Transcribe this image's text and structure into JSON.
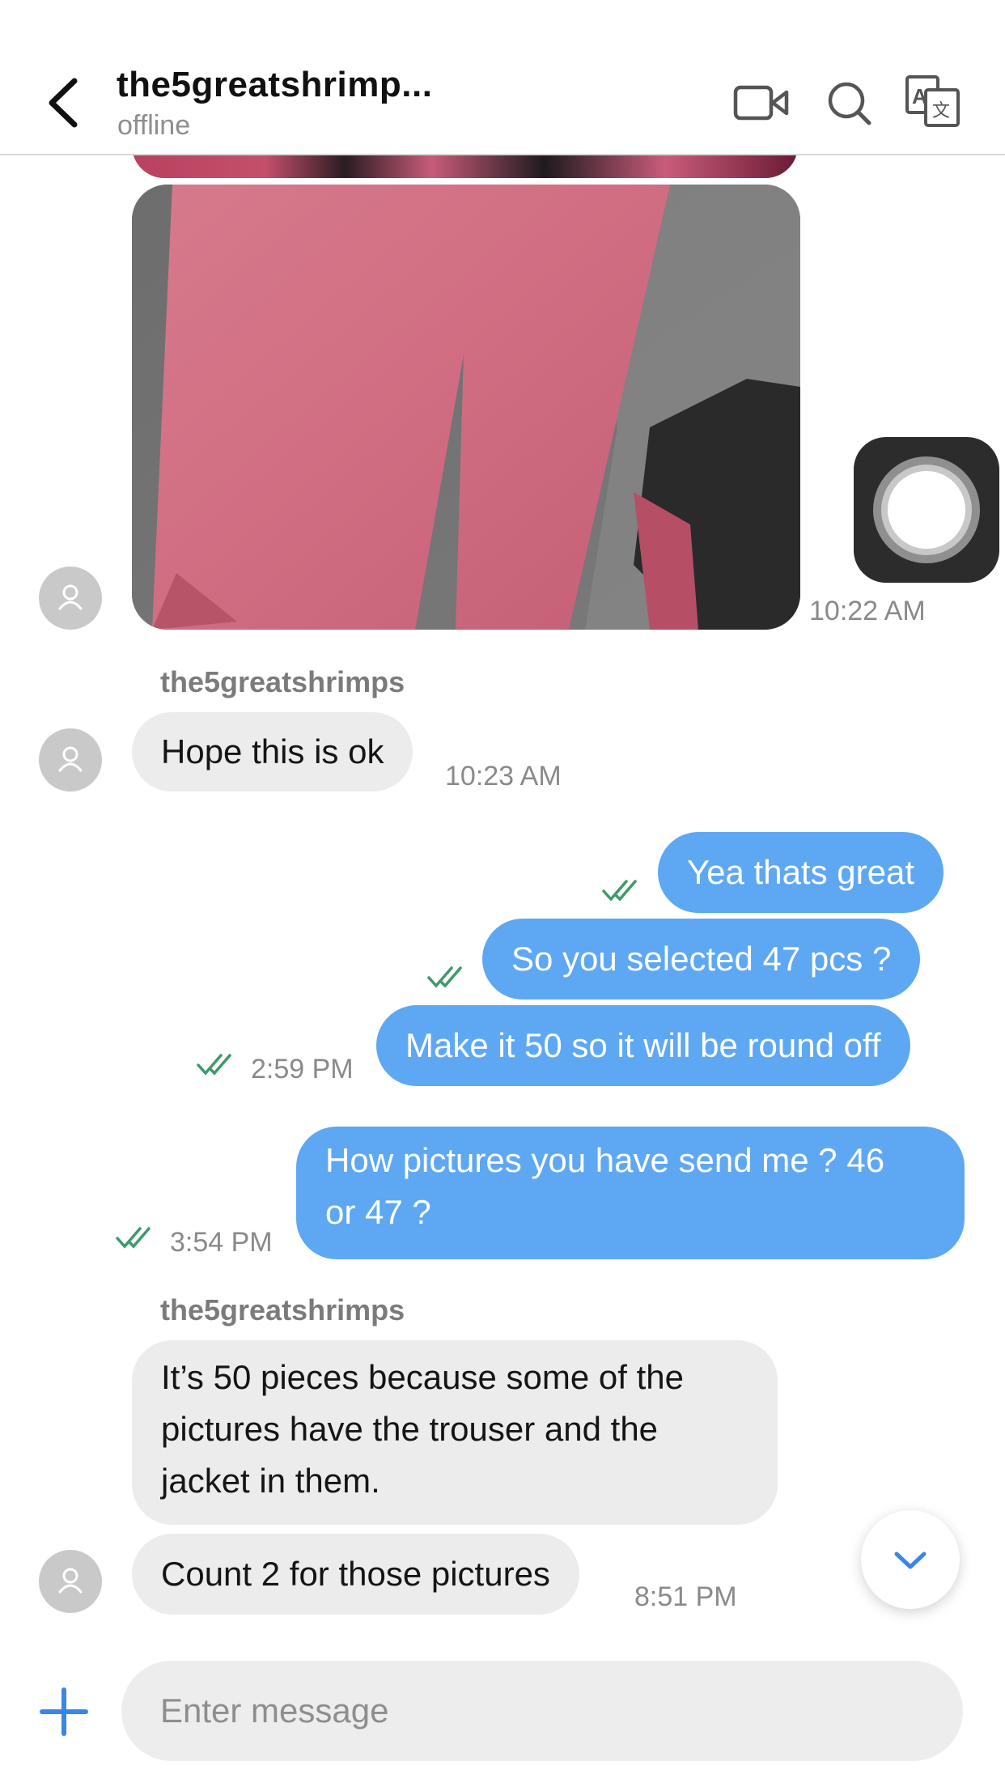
{
  "header": {
    "title": "the5greatshrimp...",
    "status": "offline",
    "icons": [
      "back-arrow-icon",
      "video-call-icon",
      "search-icon",
      "translate-icon"
    ]
  },
  "messages": {
    "image_time": "10:22 AM",
    "group1": {
      "sender": "the5greatshrimps",
      "text": "Hope this is ok",
      "time": "10:23 AM"
    },
    "outgoing1": {
      "msg1": "Yea thats great",
      "msg2": "So you selected 47 pcs ?",
      "msg3": "Make it 50 so it will be round off",
      "time": "2:59 PM"
    },
    "outgoing2": {
      "line1": "How pictures you have send me ? 46",
      "line2": "or 47 ?",
      "time": "3:54 PM"
    },
    "group2": {
      "sender": "the5greatshrimps",
      "msg1_line1": "It’s 50 pieces because some of the",
      "msg1_line2": "pictures have the trouser and the",
      "msg1_line3": "jacket in them.",
      "msg2": "Count 2 for those pictures",
      "time": "8:51 PM"
    }
  },
  "composer": {
    "placeholder": "Enter message"
  },
  "colors": {
    "outgoing_bubble": "#5ea8f3",
    "incoming_bubble": "#ececec",
    "read_check": "#3d9a6b",
    "accent": "#3a86e8"
  }
}
